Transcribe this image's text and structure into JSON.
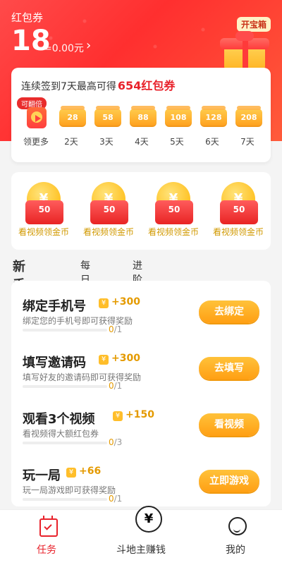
{
  "header": {
    "label": "红包券",
    "count": "18",
    "equivalent": "=0.00元",
    "arrow": "›",
    "open_box": "开宝箱"
  },
  "checkin": {
    "title_prefix": "连续签到7天最高可得",
    "title_highlight": "654红包券",
    "double_badge": "可翻倍",
    "first_label": "领更多",
    "items": [
      {
        "value": "28",
        "day": "2天"
      },
      {
        "value": "58",
        "day": "3天"
      },
      {
        "value": "88",
        "day": "4天"
      },
      {
        "value": "108",
        "day": "5天"
      },
      {
        "value": "128",
        "day": "6天"
      },
      {
        "value": "208",
        "day": "7天"
      }
    ]
  },
  "videos": {
    "items": [
      {
        "amount": "50",
        "label": "看视频领金币"
      },
      {
        "amount": "50",
        "label": "看视频领金币"
      },
      {
        "amount": "50",
        "label": "看视频领金币"
      },
      {
        "amount": "50",
        "label": "看视频领金币"
      }
    ],
    "yen": "¥"
  },
  "tabs": [
    "新手任务",
    "每日任务",
    "进阶任务"
  ],
  "tasks": [
    {
      "title": "绑定手机号",
      "reward": "+300",
      "desc": "绑定您的手机号即可获得奖励",
      "current": "0",
      "total": "/1",
      "progress": 0,
      "button": "去绑定"
    },
    {
      "title": "填写邀请码",
      "reward": "+300",
      "desc": "填写好友的邀请码即可获得奖励",
      "current": "0",
      "total": "/1",
      "progress": 0,
      "button": "去填写"
    },
    {
      "title": "观看3个视频",
      "reward": "+150",
      "desc": "看视频得大额红包券",
      "current": "0",
      "total": "/3",
      "progress": 0,
      "button": "看视频"
    },
    {
      "title": "玩一局",
      "reward": "+66",
      "desc": "玩一局游戏即可获得奖励",
      "current": "0",
      "total": "/1",
      "progress": 0,
      "button": "立即游戏"
    }
  ],
  "tabbar": {
    "items": [
      {
        "label": "任务",
        "icon": "calendar-check-icon"
      },
      {
        "label": "斗地主赚钱",
        "icon": "yen-coin-icon"
      },
      {
        "label": "我的",
        "icon": "smile-face-icon"
      }
    ],
    "yen": "¥"
  }
}
